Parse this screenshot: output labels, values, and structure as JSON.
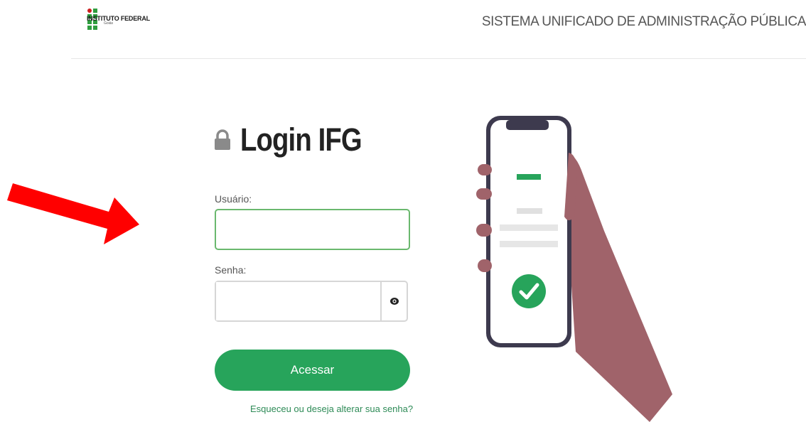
{
  "header": {
    "logo_text": "INSTITUTO FEDERAL",
    "logo_subtext": "Goiás",
    "system_title": "SISTEMA UNIFICADO DE ADMINISTRAÇÃO PÚBLICA"
  },
  "login": {
    "title": "Login IFG",
    "title_icon": "lock-icon",
    "username_label": "Usuário:",
    "username_value": "",
    "password_label": "Senha:",
    "password_value": "",
    "password_toggle_icon": "eye-icon",
    "submit_label": "Acessar",
    "forgot_link": "Esqueceu ou deseja alterar sua senha?"
  },
  "colors": {
    "primary_green": "#27a45b",
    "input_focus_border": "#6ab86e",
    "arrow_red": "#ff0000",
    "logo_red": "#cc1f1f",
    "logo_green": "#2f9e3f",
    "hand_skin": "#a0636a",
    "phone_frame": "#3d3a4e"
  }
}
